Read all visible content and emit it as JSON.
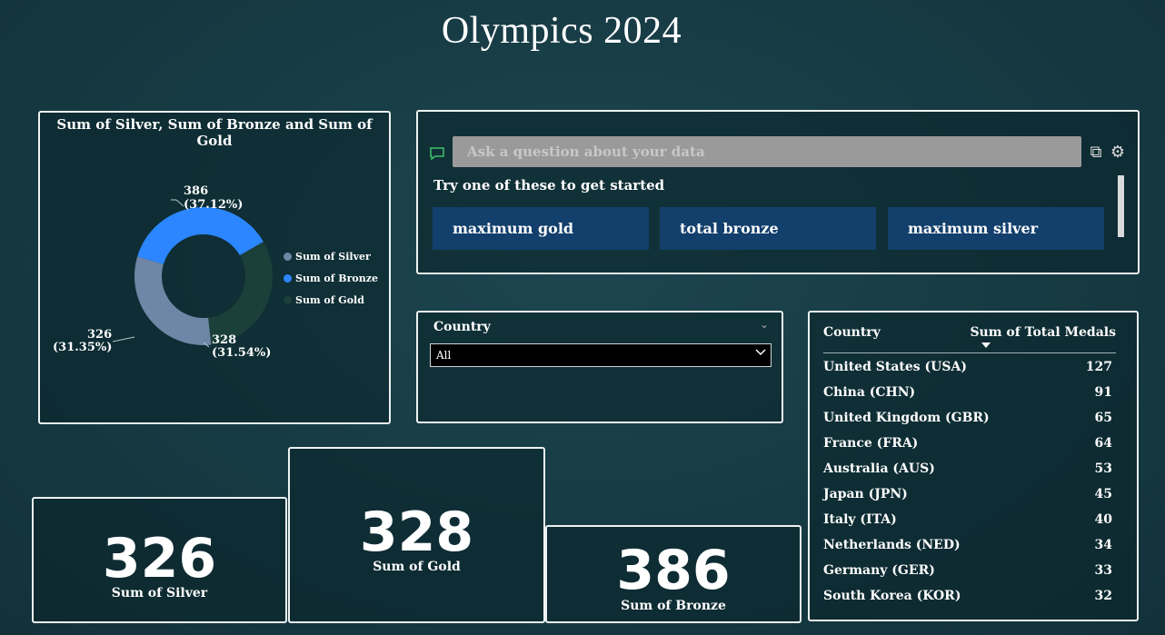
{
  "page_title": "Olympics 2024",
  "donut": {
    "title": "Sum of Silver, Sum of Bronze and Sum of Gold",
    "labels": {
      "bronze_value": "386",
      "bronze_pct": "(37.12%)",
      "gold_value": "328",
      "gold_pct": "(31.54%)",
      "silver_value": "326",
      "silver_pct": "(31.35%)"
    },
    "legend": [
      "Sum of Silver",
      "Sum of Bronze",
      "Sum of Gold"
    ]
  },
  "chart_data": {
    "type": "pie",
    "title": "Sum of Silver, Sum of Bronze and Sum of Gold",
    "categories": [
      "Sum of Silver",
      "Sum of Bronze",
      "Sum of Gold"
    ],
    "values": [
      326,
      386,
      328
    ],
    "percentages": [
      31.35,
      37.12,
      31.54
    ],
    "colors": [
      "#6f86a6",
      "#2b86ff",
      "#1b4039"
    ],
    "legend": "right",
    "donut": true
  },
  "qa": {
    "placeholder": "Ask a question about your data",
    "prompt": "Try one of these to get started",
    "suggestions": [
      "maximum gold",
      "total bronze",
      "maximum silver"
    ]
  },
  "slicer": {
    "label": "Country",
    "selected": "All"
  },
  "table": {
    "col1": "Country",
    "col2": "Sum of Total Medals",
    "rows": [
      {
        "country": "United States (USA)",
        "medals": "127"
      },
      {
        "country": "China (CHN)",
        "medals": "91"
      },
      {
        "country": "United Kingdom (GBR)",
        "medals": "65"
      },
      {
        "country": "France (FRA)",
        "medals": "64"
      },
      {
        "country": "Australia (AUS)",
        "medals": "53"
      },
      {
        "country": "Japan (JPN)",
        "medals": "45"
      },
      {
        "country": "Italy (ITA)",
        "medals": "40"
      },
      {
        "country": "Netherlands (NED)",
        "medals": "34"
      },
      {
        "country": "Germany (GER)",
        "medals": "33"
      },
      {
        "country": "South Korea (KOR)",
        "medals": "32"
      }
    ]
  },
  "cards": {
    "silver": {
      "value": "326",
      "label": "Sum of Silver"
    },
    "gold": {
      "value": "328",
      "label": "Sum of Gold"
    },
    "bronze": {
      "value": "386",
      "label": "Sum of Bronze"
    }
  }
}
